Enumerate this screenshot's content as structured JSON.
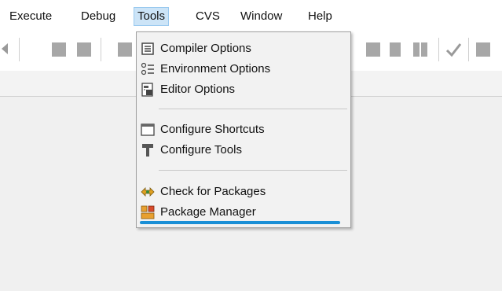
{
  "menubar": {
    "items": [
      "Execute",
      "Debug",
      "Tools",
      "CVS",
      "Window",
      "Help"
    ],
    "active": "Tools"
  },
  "tools_menu": {
    "groups": [
      [
        "Compiler Options",
        "Environment Options",
        "Editor Options"
      ],
      [
        "Configure Shortcuts",
        "Configure Tools"
      ],
      [
        "Check for Packages",
        "Package Manager"
      ]
    ],
    "icons": [
      "compiler-options-icon",
      "environment-options-icon",
      "editor-options-icon",
      "configure-shortcuts-icon",
      "configure-tools-icon",
      "check-for-packages-icon",
      "package-manager-icon"
    ]
  },
  "colors": {
    "menu_active_bg": "#cce4f7",
    "highlight_line": "#1a8fd6"
  }
}
